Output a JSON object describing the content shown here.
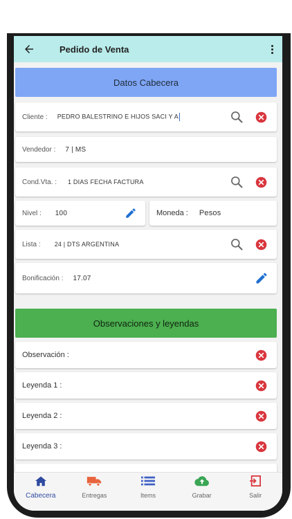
{
  "appbar": {
    "title": "Pedido de Venta"
  },
  "sections": {
    "header": "Datos Cabecera",
    "observations": "Observaciones y leyendas"
  },
  "fields": {
    "cliente": {
      "label": "Cliente :",
      "value": "PEDRO BALESTRINO E HIJOS SACI Y A"
    },
    "vendedor": {
      "label": "Vendedor :",
      "value": "7 | MS"
    },
    "cond_vta": {
      "label": "Cond.Vta. :",
      "value": "1 DIAS FECHA FACTURA"
    },
    "nivel": {
      "label": "Nivel :",
      "value": "100"
    },
    "moneda": {
      "label": "Moneda :",
      "value": "Pesos"
    },
    "lista": {
      "label": "Lista :",
      "value": "24 | DTS ARGENTINA"
    },
    "bonificacion": {
      "label": "Bonificación :",
      "value": "17.07"
    }
  },
  "observations": {
    "observacion": {
      "label": "Observación :"
    },
    "leyenda1": {
      "label": "Leyenda 1 :"
    },
    "leyenda2": {
      "label": "Leyenda 2 :"
    },
    "leyenda3": {
      "label": "Leyenda 3 :"
    }
  },
  "bottom_nav": [
    {
      "label": "Cabecera",
      "icon": "home-icon",
      "active": true
    },
    {
      "label": "Entregas",
      "icon": "truck-icon"
    },
    {
      "label": "Items",
      "icon": "list-icon"
    },
    {
      "label": "Grabar",
      "icon": "cloud-upload-icon"
    },
    {
      "label": "Salir",
      "icon": "exit-icon"
    }
  ],
  "colors": {
    "appbar": "#b9ecea",
    "header_section": "#7fa6f5",
    "observations_section": "#4caf50",
    "clear_icon": "#d9363e",
    "edit_icon": "#1f6fd1",
    "active_nav": "#2f4aa0"
  }
}
